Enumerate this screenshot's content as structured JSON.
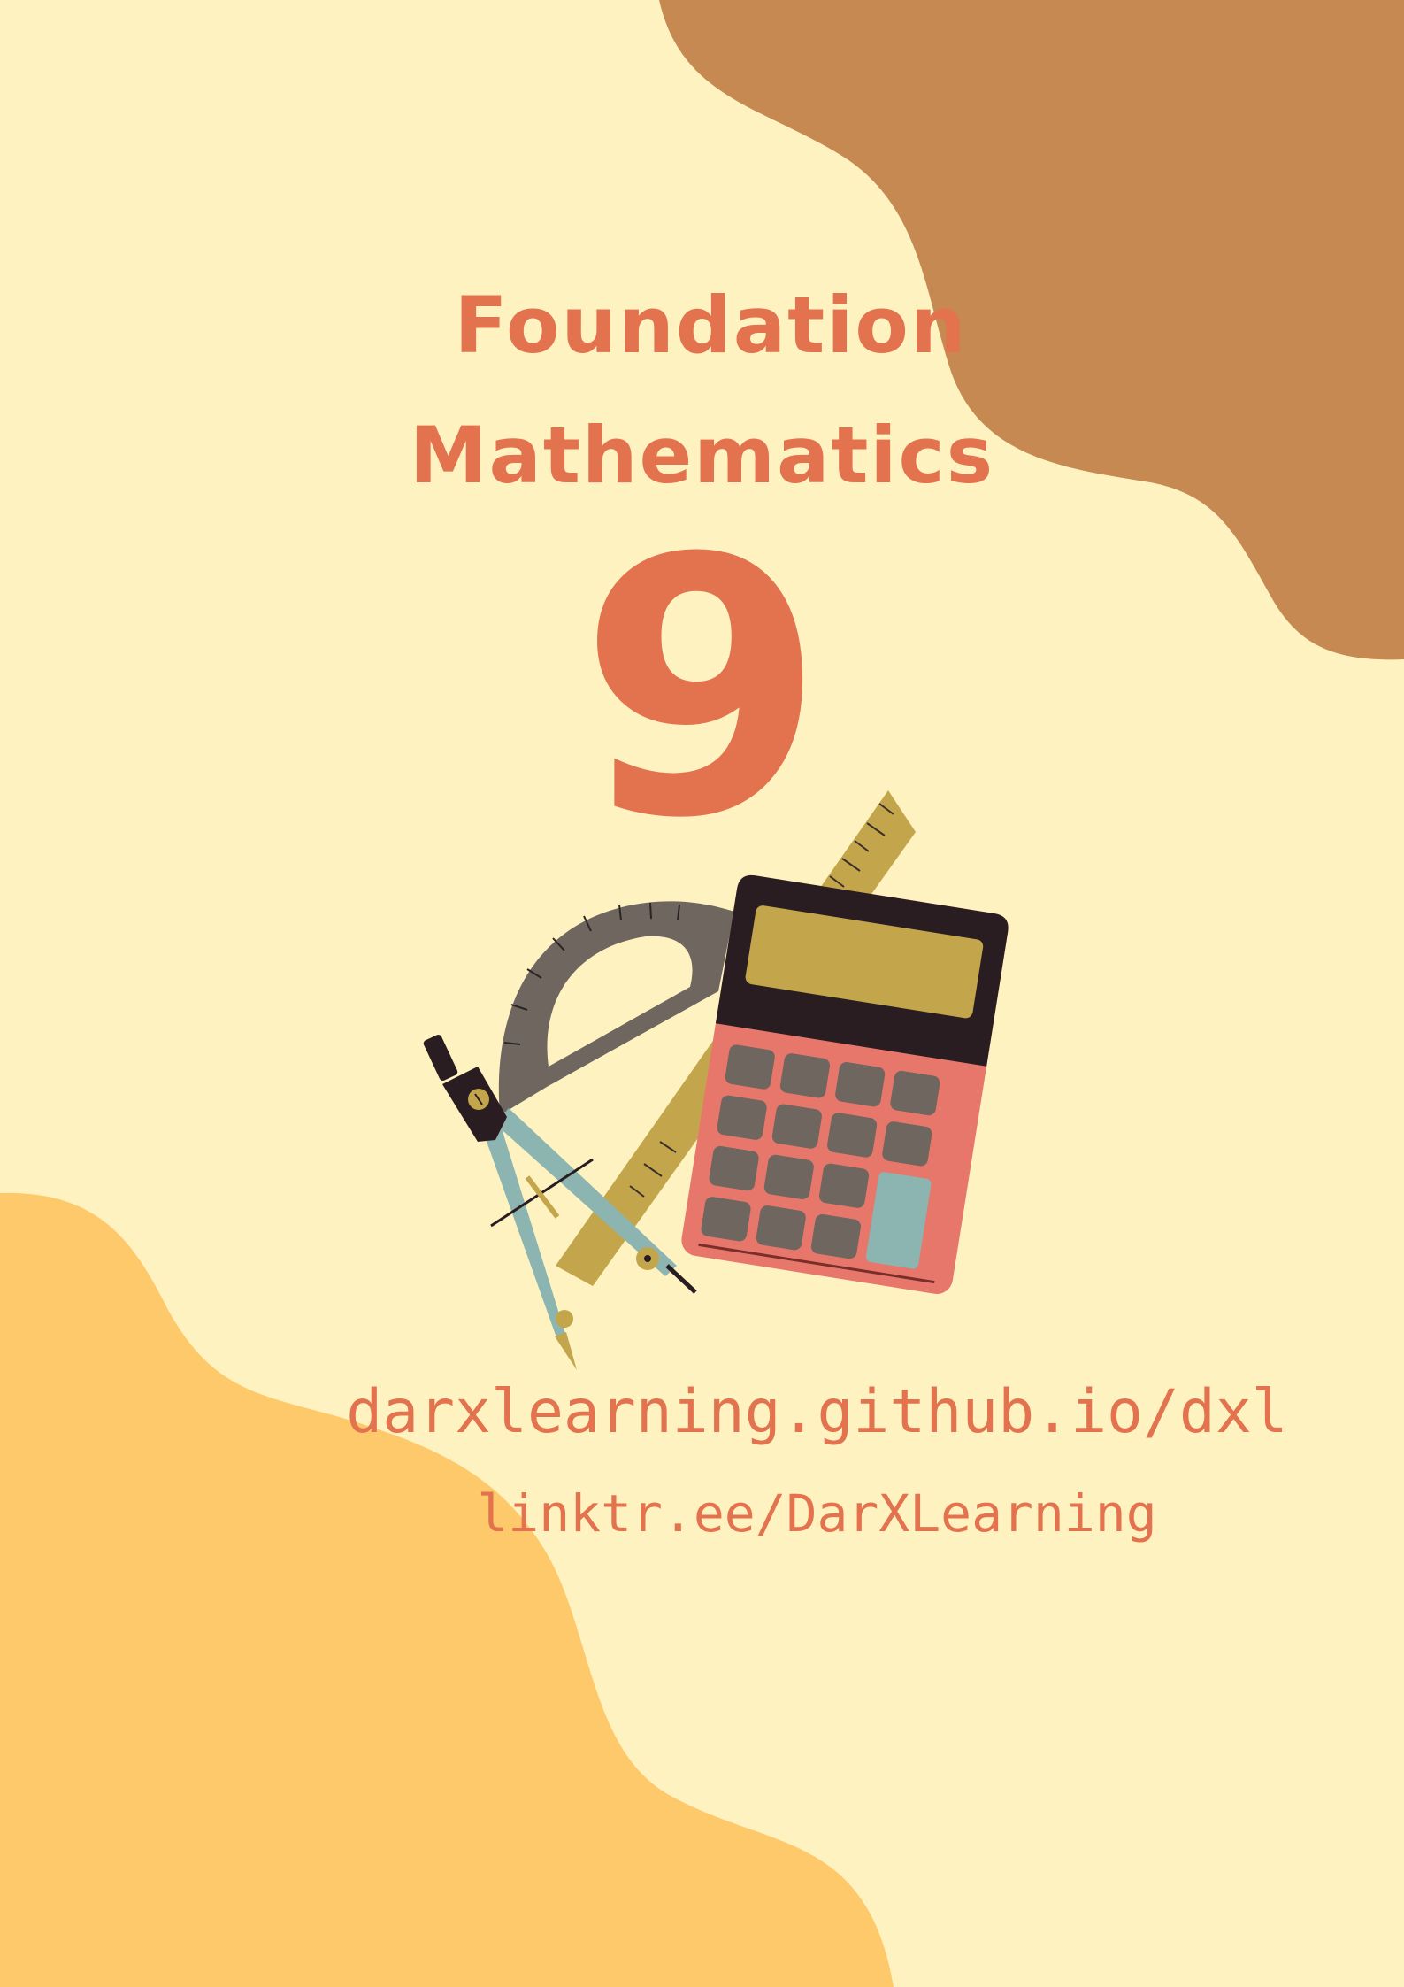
{
  "cover": {
    "title_line_1": "Foundation",
    "title_line_2": "Mathematics",
    "grade": "9",
    "link_1": "darxlearning.github.io/dxl",
    "link_2": "linktr.ee/DarXLearning"
  },
  "colors": {
    "background": "#fef2c0",
    "blob_top_right": "#c68952",
    "blob_bottom_left": "#fec96b",
    "text_accent": "#e2734e"
  },
  "illustration": {
    "icons": [
      "calculator-icon",
      "ruler-icon",
      "protractor-icon",
      "compass-icon"
    ]
  }
}
